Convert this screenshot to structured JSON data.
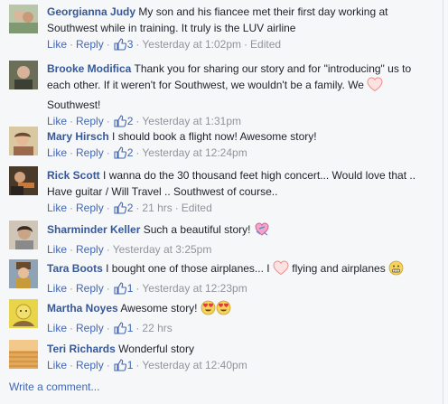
{
  "comments": [
    {
      "author": "Georgianna Judy",
      "text": "My son and his fiancee met their first day working at Southwest while in training. It truly is the LUV airline",
      "like": "Like",
      "reply": "Reply",
      "likes": "3",
      "time": "Yesterday at 1:02pm",
      "edited": "Edited"
    },
    {
      "author": "Brooke Modifica",
      "text": "Thank you for sharing our story and for \"introducing\" us to each other. If it weren't for Southwest, we wouldn't be a family. We",
      "text_after": "Southwest!",
      "emoji": "heart-icon",
      "like": "Like",
      "reply": "Reply",
      "likes": "2",
      "time": "Yesterday at 1:31pm"
    },
    {
      "author": "Mary Hirsch",
      "text": "I should book a flight now! Awesome story!",
      "like": "Like",
      "reply": "Reply",
      "likes": "2",
      "time": "Yesterday at 12:24pm"
    },
    {
      "author": "Rick Scott",
      "text": "I wanna do the 30 thousand feet high concert... Would love that .. Have guitar / Will Travel .. Southwest of course..",
      "like": "Like",
      "reply": "Reply",
      "likes": "2",
      "time": "21 hrs",
      "edited": "Edited"
    },
    {
      "author": "Sharminder Keller",
      "text": "Such a beautiful story!",
      "emoji": "heart-ribbon-icon",
      "like": "Like",
      "reply": "Reply",
      "time": "Yesterday at 3:25pm"
    },
    {
      "author": "Tara Boots",
      "text": "I bought one of those airplanes... I",
      "text_after": "flying and airplanes",
      "emoji": "heart-icon",
      "emoji_end": "grimace-emoji-icon",
      "like": "Like",
      "reply": "Reply",
      "likes": "1",
      "time": "Yesterday at 12:23pm"
    },
    {
      "author": "Martha Noyes",
      "text": "Awesome story!",
      "emoji": "heart-eyes-emoji-icon",
      "like": "Like",
      "reply": "Reply",
      "likes": "1",
      "time": "22 hrs"
    },
    {
      "author": "Teri Richards",
      "text": "Wonderful story",
      "like": "Like",
      "reply": "Reply",
      "likes": "1",
      "time": "Yesterday at 12:40pm"
    }
  ],
  "write_comment": "Write a comment...",
  "colors": {
    "link": "#365899",
    "action": "#4267b2",
    "meta": "#90949c",
    "background": "#f6f7f9",
    "heart": "#f7a8a8"
  }
}
